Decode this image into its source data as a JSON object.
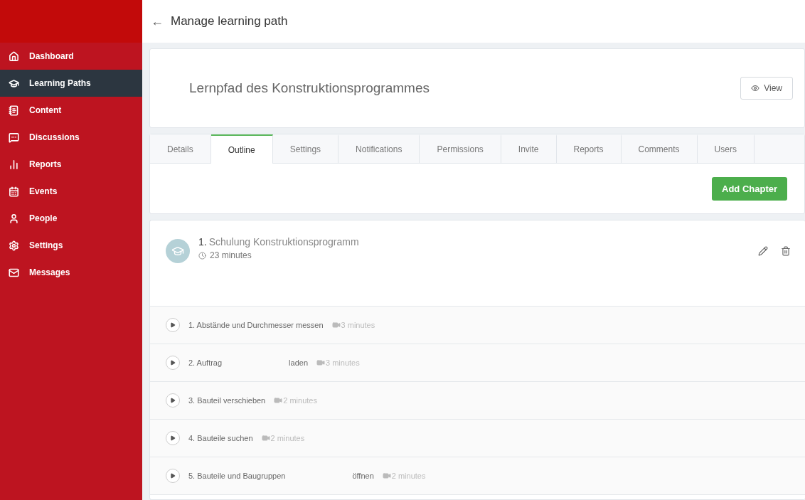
{
  "header": {
    "back": "←",
    "title": "Manage learning path"
  },
  "sidebar": {
    "items": [
      {
        "label": "Dashboard",
        "selected": false
      },
      {
        "label": "Learning Paths",
        "selected": true
      },
      {
        "label": "Content",
        "selected": false
      },
      {
        "label": "Discussions",
        "selected": false
      },
      {
        "label": "Reports",
        "selected": false
      },
      {
        "label": "Events",
        "selected": false
      },
      {
        "label": "People",
        "selected": false
      },
      {
        "label": "Settings",
        "selected": false
      },
      {
        "label": "Messages",
        "selected": false
      }
    ]
  },
  "path": {
    "title": "Lernpfad des Konstruktionsprogrammes",
    "view_button": "View"
  },
  "tabs": [
    {
      "label": "Details",
      "selected": false
    },
    {
      "label": "Outline",
      "selected": true
    },
    {
      "label": "Settings",
      "selected": false
    },
    {
      "label": "Notifications",
      "selected": false
    },
    {
      "label": "Permissions",
      "selected": false
    },
    {
      "label": "Invite",
      "selected": false
    },
    {
      "label": "Reports",
      "selected": false
    },
    {
      "label": "Comments",
      "selected": false
    },
    {
      "label": "Users",
      "selected": false
    }
  ],
  "add_chapter": "Add Chapter",
  "chapter": {
    "number": "1.",
    "title": "Schulung Konstruktionsprogramm",
    "duration": "23 minutes",
    "lessons": [
      {
        "title": [
          "1. Abstände und Durchmesser messen"
        ],
        "duration": "3 minutes"
      },
      {
        "title": [
          "2. Auftrag",
          "laden"
        ],
        "duration": "3 minutes"
      },
      {
        "title": [
          "3. Bauteil verschieben"
        ],
        "duration": "2 minutes"
      },
      {
        "title": [
          "4. Bauteile suchen"
        ],
        "duration": "2 minutes"
      },
      {
        "title": [
          "5. Bauteile und Baugruppen",
          "öffnen"
        ],
        "duration": "2 minutes"
      }
    ]
  }
}
